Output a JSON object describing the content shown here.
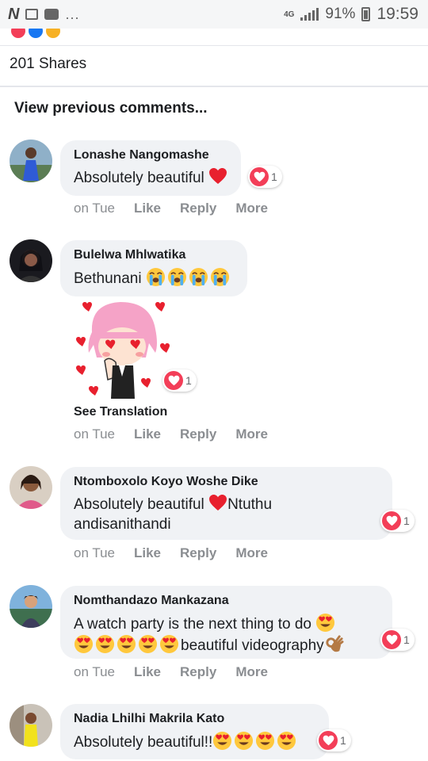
{
  "status_bar": {
    "network": "4G",
    "battery": "91%",
    "time": "19:59"
  },
  "post": {
    "shares": "201 Shares",
    "view_previous": "View previous comments..."
  },
  "actions_labels": {
    "like": "Like",
    "reply": "Reply",
    "more": "More",
    "see_translation": "See Translation"
  },
  "comments": [
    {
      "name": "Lonashe Nangomashe",
      "text": "Absolutely beautiful",
      "time": "on Tue",
      "reactions": "1"
    },
    {
      "name": "Bulelwa Mhlwatika",
      "text": "Bethunani",
      "time": "on Tue",
      "reactions": "1"
    },
    {
      "name": "Ntomboxolo Koyo Woshe Dike",
      "text_a": "Absolutely beautiful",
      "text_b": "Ntuthu",
      "text_c": "andisanithandi",
      "time": "on Tue",
      "reactions": "1"
    },
    {
      "name": "Nomthandazo Mankazana",
      "text_a": "A watch party is the next thing to do",
      "text_b": "beautiful videography",
      "time": "on Tue",
      "reactions": "1"
    },
    {
      "name": "Nadia Lhilhi Makrila Kato",
      "text": "Absolutely beautiful!!",
      "reactions": "1"
    }
  ],
  "colors": {
    "love": "#f33e58",
    "bubble": "#f0f2f5",
    "meta": "#8a8d91"
  }
}
